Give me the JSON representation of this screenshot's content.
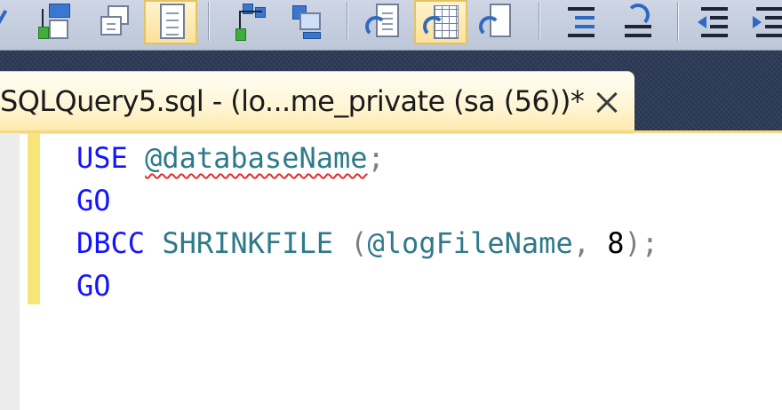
{
  "toolbar": {
    "buttons": [
      {
        "name": "query-options-button",
        "icon": "window-tree-icon",
        "active": false
      },
      {
        "name": "windows-button",
        "icon": "windows-icon",
        "active": false
      },
      {
        "name": "results-to-file-button",
        "icon": "document-list-icon",
        "active": true
      },
      {
        "name": "query-plan-button",
        "icon": "hierarchy-icon",
        "active": false
      },
      {
        "name": "connect-button",
        "icon": "computer-network-icon",
        "active": false
      },
      {
        "name": "results-to-text-button",
        "icon": "results-text-icon",
        "active": false
      },
      {
        "name": "results-to-grid-button",
        "icon": "results-grid-icon",
        "active": true
      },
      {
        "name": "results-to-file-button-2",
        "icon": "results-file-icon",
        "active": false
      },
      {
        "name": "comment-button",
        "icon": "comment-lines-icon",
        "active": false
      },
      {
        "name": "uncomment-button",
        "icon": "uncomment-icon",
        "active": false
      },
      {
        "name": "decrease-indent-button",
        "icon": "outdent-icon",
        "active": false
      },
      {
        "name": "increase-indent-button",
        "icon": "indent-icon",
        "active": false
      }
    ]
  },
  "tab": {
    "title": "SQLQuery5.sql - (lo...me_private (sa (56))*",
    "close_icon": "close-icon"
  },
  "editor": {
    "lines": [
      [
        {
          "t": "USE",
          "c": "kw"
        },
        {
          "t": " ",
          "c": ""
        },
        {
          "t": "@databaseName",
          "c": "var squiggle"
        },
        {
          "t": ";",
          "c": "punct"
        }
      ],
      [
        {
          "t": "GO",
          "c": "kw"
        }
      ],
      [
        {
          "t": "DBCC",
          "c": "kw"
        },
        {
          "t": " ",
          "c": ""
        },
        {
          "t": "SHRINKFILE",
          "c": "var"
        },
        {
          "t": " ",
          "c": ""
        },
        {
          "t": "(",
          "c": "punct"
        },
        {
          "t": "@logFileName",
          "c": "var"
        },
        {
          "t": ", ",
          "c": "punct"
        },
        {
          "t": "8",
          "c": "num"
        },
        {
          "t": ");",
          "c": "punct"
        }
      ],
      [
        {
          "t": "GO",
          "c": "kw"
        }
      ]
    ]
  },
  "colors": {
    "keyword": "#1414ff",
    "identifier": "#2e7a8a",
    "punctuation": "#7f7f7f",
    "tab_active": "#fff6d6",
    "change_bar": "#f6e67a"
  }
}
